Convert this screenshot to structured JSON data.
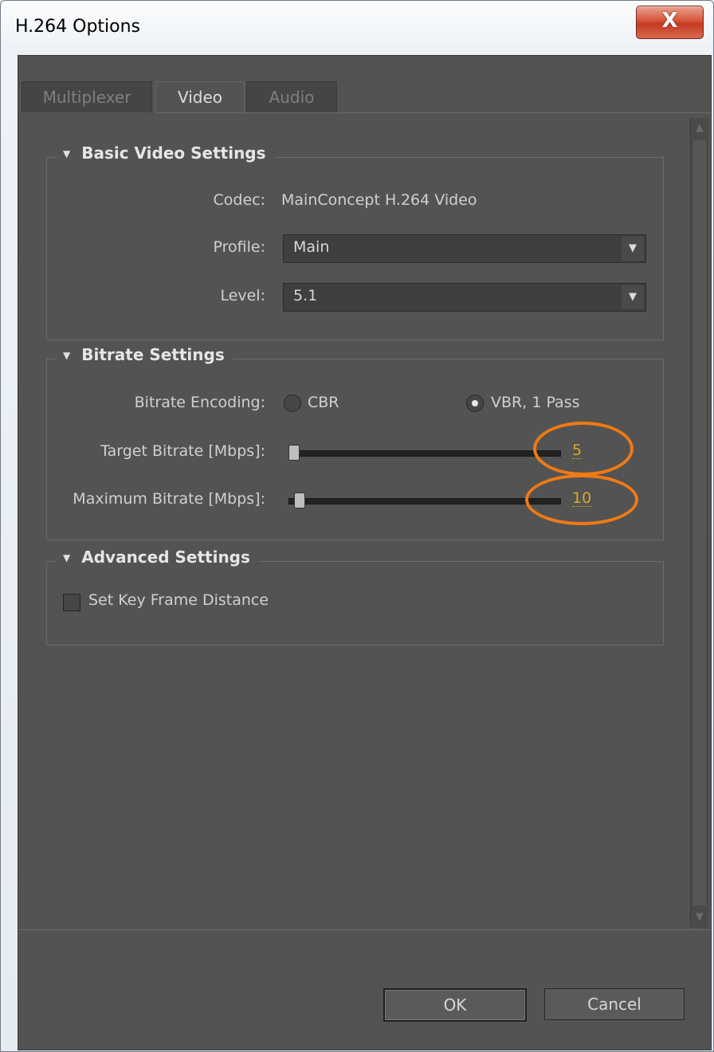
{
  "window": {
    "title": "H.264 Options",
    "close_glyph": "X"
  },
  "tabs": [
    {
      "label": "Multiplexer",
      "active": false
    },
    {
      "label": "Video",
      "active": true
    },
    {
      "label": "Audio",
      "active": false
    }
  ],
  "basic_video": {
    "header": "Basic Video Settings",
    "codec_label": "Codec:",
    "codec_value": "MainConcept H.264 Video",
    "profile_label": "Profile:",
    "profile_value": "Main",
    "level_label": "Level:",
    "level_value": "5.1"
  },
  "bitrate": {
    "header": "Bitrate Settings",
    "encoding_label": "Bitrate Encoding:",
    "cbr_label": "CBR",
    "vbr_label": "VBR, 1 Pass",
    "selected_mode": "VBR, 1 Pass",
    "target_label": "Target Bitrate [Mbps]:",
    "target_value": "5",
    "max_label": "Maximum Bitrate [Mbps]:",
    "max_value": "10"
  },
  "advanced": {
    "header": "Advanced Settings",
    "keyframe_label": "Set Key Frame Distance",
    "keyframe_checked": false
  },
  "buttons": {
    "ok": "OK",
    "cancel": "Cancel"
  },
  "icons": {
    "section_toggle": "triangle-down-icon",
    "dropdown": "triangle-down-icon",
    "scroll_up": "arrow-up-icon",
    "scroll_down": "arrow-down-icon"
  },
  "colors": {
    "panel_bg": "#535353",
    "value_highlight": "#d8a928",
    "annotation_circle": "#f07a14",
    "close_button": "#c94a32"
  }
}
